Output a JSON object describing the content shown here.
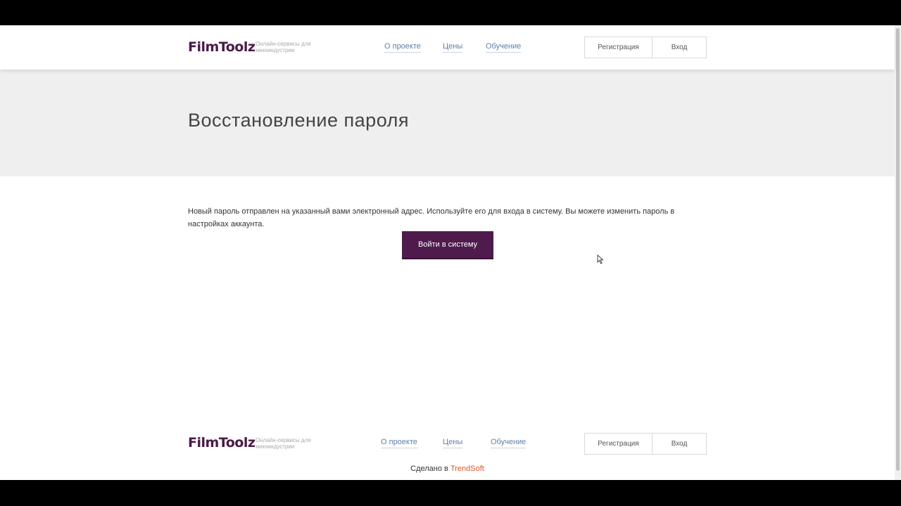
{
  "header": {
    "logo": "FilmToolz",
    "tagline": "Онлайн-сервисы для киноиндустрии",
    "nav": [
      {
        "label": "О проекте"
      },
      {
        "label": "Цены"
      },
      {
        "label": "Обучение"
      }
    ],
    "register_label": "Регистрация",
    "login_label": "Вход"
  },
  "hero": {
    "title": "Восстановление пароля"
  },
  "main": {
    "message": "Новый пароль отправлен на указанный вами электронный адрес. Используйте его для входа в систему. Вы можете изменить пароль в настройках аккаунта.",
    "login_button": "Войти в систему"
  },
  "footer": {
    "logo": "FilmToolz",
    "tagline": "Онлайн-сервисы для киноиндустрии",
    "nav": [
      {
        "label": "О проекте"
      },
      {
        "label": "Цены"
      },
      {
        "label": "Обучение"
      }
    ],
    "register_label": "Регистрация",
    "login_label": "Вход",
    "made_in_prefix": "Сделано в",
    "made_in_brand": "TrendSoft"
  },
  "colors": {
    "brand": "#4f1b4d",
    "link": "#5e7fa8",
    "hero_bg": "#efefef",
    "accent": "#e0542a"
  }
}
